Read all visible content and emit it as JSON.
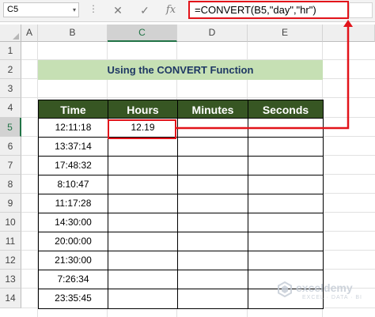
{
  "formula_bar": {
    "name_box": "C5",
    "name_box_dropdown": "▾",
    "separator": "⋮",
    "cancel_glyph": "✕",
    "enter_glyph": "✓",
    "fx_glyph": "fx",
    "formula": "=CONVERT(B5,\"day\",\"hr\")"
  },
  "columns": [
    "A",
    "B",
    "C",
    "D",
    "E"
  ],
  "active_column": "C",
  "rows": [
    "1",
    "2",
    "3",
    "4",
    "5",
    "6",
    "7",
    "8",
    "9",
    "10",
    "11",
    "12",
    "13",
    "14"
  ],
  "active_row": "5",
  "title": "Using the CONVERT Function",
  "table": {
    "headers": [
      "Time",
      "Hours",
      "Minutes",
      "Seconds"
    ],
    "rows": [
      [
        "12:11:18",
        "12.19",
        "",
        ""
      ],
      [
        "13:37:14",
        "",
        "",
        ""
      ],
      [
        "17:48:32",
        "",
        "",
        ""
      ],
      [
        "8:10:47",
        "",
        "",
        ""
      ],
      [
        "11:17:28",
        "",
        "",
        ""
      ],
      [
        "14:30:00",
        "",
        "",
        ""
      ],
      [
        "20:00:00",
        "",
        "",
        ""
      ],
      [
        "21:30:00",
        "",
        "",
        ""
      ],
      [
        "7:26:34",
        "",
        "",
        ""
      ],
      [
        "23:35:45",
        "",
        "",
        ""
      ]
    ]
  },
  "watermark": {
    "name": "exceldemy",
    "tagline": "EXCEL · DATA · BI"
  },
  "colors": {
    "header_fill": "#375623",
    "title_fill": "#c6e0b4",
    "highlight": "#e2131a"
  }
}
